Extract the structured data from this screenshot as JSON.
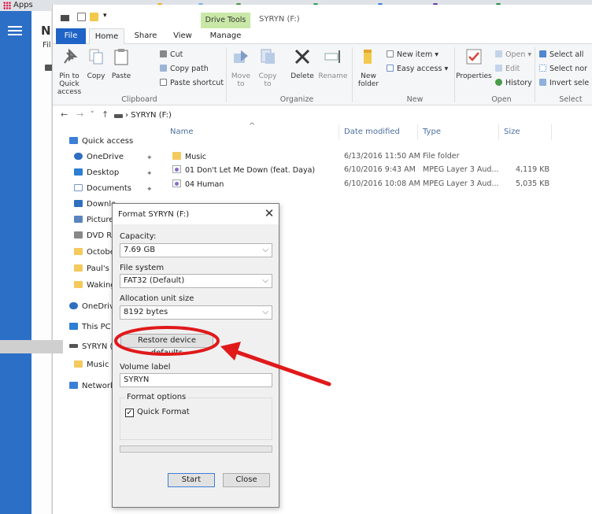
{
  "browser": {
    "bookmarks": {
      "apps_label": "Apps"
    }
  },
  "background_app": {
    "title_partial": "N",
    "subtitle_partial": "Fil"
  },
  "explorer": {
    "quick_access_arrow": "▾",
    "contextual_tab_group": "Drive Tools",
    "window_title": "SYRYN (F:)",
    "tabs": {
      "file": "File",
      "home": "Home",
      "share": "Share",
      "view": "View",
      "manage": "Manage"
    },
    "ribbon": {
      "clipboard": {
        "pin": "Pin to Quick access",
        "copy": "Copy",
        "paste": "Paste",
        "cut": "Cut",
        "copy_path": "Copy path",
        "paste_shortcut": "Paste shortcut",
        "label": "Clipboard"
      },
      "organize": {
        "move_to": "Move to",
        "copy_to": "Copy to",
        "delete": "Delete",
        "rename": "Rename",
        "label": "Organize"
      },
      "new": {
        "new_folder": "New folder",
        "new_item": "New item",
        "easy_access": "Easy access",
        "label": "New"
      },
      "open": {
        "properties": "Properties",
        "open": "Open",
        "edit": "Edit",
        "history": "History",
        "label": "Open"
      },
      "select": {
        "select_all": "Select all",
        "select_none": "Select nor",
        "invert": "Invert sele",
        "label": "Select"
      }
    },
    "address": {
      "back": "←",
      "forward": "→",
      "recent": "˅",
      "up": "↑",
      "path": "› SYRYN (F:)"
    },
    "nav_pane": {
      "quick_access": "Quick access",
      "onedrive": "OneDrive",
      "desktop": "Desktop",
      "documents": "Documents",
      "downloads": "Downlo",
      "pictures": "Picture",
      "dvd": "DVD R\\",
      "october": "Octobe",
      "pauls": "Paul's ",
      "waking": "Waking",
      "onedrive2": "OneDriv",
      "this_pc": "This PC",
      "syryn": "SYRYN (",
      "music": "Music",
      "network": "Network"
    },
    "columns": {
      "name": "Name",
      "date": "Date modified",
      "type": "Type",
      "size": "Size",
      "sort_arrow": "^"
    },
    "files": [
      {
        "name": "Music",
        "date": "6/13/2016 11:50 AM",
        "type": "File folder",
        "size": ""
      },
      {
        "name": "01 Don't Let Me Down (feat. Daya)",
        "date": "6/10/2016 9:43 AM",
        "type": "MPEG Layer 3 Aud...",
        "size": "4,119 KB"
      },
      {
        "name": "04 Human",
        "date": "6/10/2016 10:08 AM",
        "type": "MPEG Layer 3 Aud...",
        "size": "5,035 KB"
      }
    ]
  },
  "dialog": {
    "title": "Format SYRYN (F:)",
    "close": "✕",
    "capacity_label": "Capacity:",
    "capacity_value": "7.69 GB",
    "filesystem_label": "File system",
    "filesystem_value": "FAT32 (Default)",
    "allocation_label": "Allocation unit size",
    "allocation_value": "8192 bytes",
    "restore_button": "Restore device defaults",
    "volume_label": "Volume label",
    "volume_value": "SYRYN",
    "format_options_label": "Format options",
    "quick_format_label": "Quick Format",
    "quick_format_checked": "✓",
    "progress": 0,
    "start_button": "Start",
    "close_button": "Close"
  },
  "annotation": {
    "color": "#e0191b"
  }
}
